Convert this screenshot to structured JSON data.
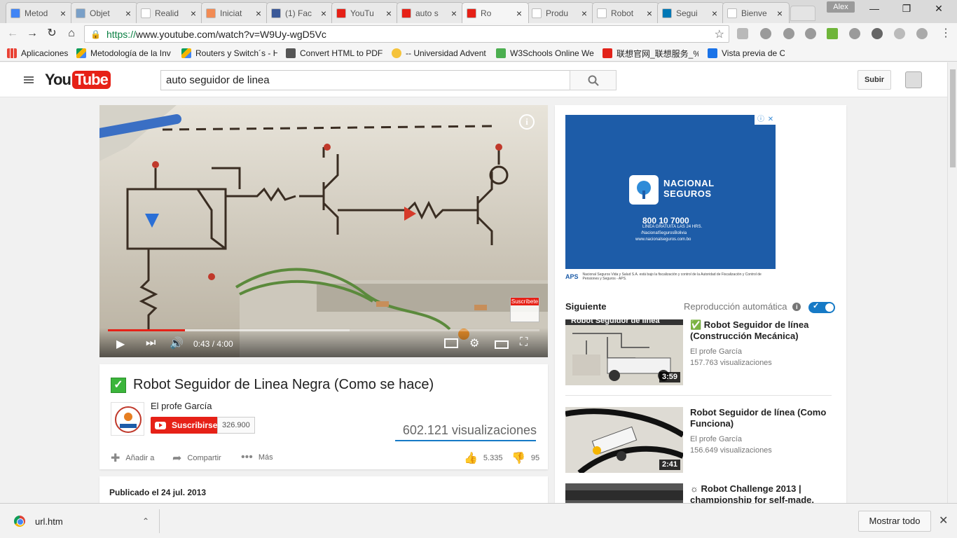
{
  "browser": {
    "tabs": [
      {
        "label": "Metod",
        "color": "#4285f4"
      },
      {
        "label": "Objet",
        "color": "#7aa0c8"
      },
      {
        "label": "Realid",
        "color": "#ffffff"
      },
      {
        "label": "Iniciat",
        "color": "#f28b54"
      },
      {
        "label": "(1) Fac",
        "color": "#3b5998"
      },
      {
        "label": "YouTu",
        "color": "#e62117"
      },
      {
        "label": "auto s",
        "color": "#e62117"
      },
      {
        "label": "Ro",
        "color": "#e62117"
      },
      {
        "label": "Produ",
        "color": "#ffffff"
      },
      {
        "label": "Robot",
        "color": "#ffffff"
      },
      {
        "label": "Segui",
        "color": "#0077b5"
      },
      {
        "label": "Bienve",
        "color": "#ffffff"
      }
    ],
    "active_tab_index": 7,
    "user": "Alex",
    "url_scheme": "https://",
    "url_rest": "www.youtube.com/watch?v=W9Uy-wgD5Vc",
    "bookmarks": [
      {
        "label": "Aplicaciones",
        "icon": "apps-grid-icon"
      },
      {
        "label": "Metodología de la Inv",
        "icon": "drive-icon"
      },
      {
        "label": "Routers y Switch´s - H",
        "icon": "drive-icon"
      },
      {
        "label": "Convert HTML to PDF",
        "icon": "pdf-icon"
      },
      {
        "label": "-- Universidad Advent",
        "icon": "emoji-icon"
      },
      {
        "label": "W3Schools Online We",
        "icon": "w3-icon"
      },
      {
        "label": "联想官网_联想服务_%",
        "icon": "lenovo-icon"
      },
      {
        "label": "Vista previa de Conta",
        "icon": "contact-icon"
      }
    ]
  },
  "youtube": {
    "logo_you": "You",
    "logo_tube": "Tube",
    "search_query": "auto seguidor de linea",
    "upload_label": "Subir"
  },
  "player": {
    "time": "0:43 / 4:00",
    "progress_played": 0.1792,
    "progress_loaded": 0.56,
    "overlay_subscribe": "Suscríbete"
  },
  "video": {
    "title": "Robot Seguidor de Linea Negra (Como se hace)",
    "channel": "El profe García",
    "subscribe_label": "Suscribirse",
    "subscriber_count": "326.900",
    "views": "602.121 visualizaciones",
    "actions": {
      "add_to": "Añadir a",
      "share": "Compartir",
      "more": "Más"
    },
    "likes": "5.335",
    "dislikes": "95",
    "published": "Publicado el 24 jul. 2013"
  },
  "ad": {
    "brand_line1": "NACIONAL",
    "brand_line2": "SEGUROS",
    "phone": "800 10 7000",
    "line1": "LÍNEA GRATUITA LAS 24 HRS.",
    "line2": "/NacionalSegurosBolivia",
    "line3": "www.nacionalseguros.com.bo",
    "footer_brand": "APS",
    "footer_text": "Nacional Seguros Vida y Salud S.A. está bajo la fiscalización y control de la Autoridad de Fiscalización y Control de Pensiones y Seguros - APS."
  },
  "sidebar": {
    "up_next": "Siguiente",
    "autoplay": "Reproducción automática",
    "autoplay_on": true,
    "items": [
      {
        "title": "✅ Robot Seguidor de línea (Construcción Mecánica)",
        "channel": "El profe García",
        "views": "157.763 visualizaciones",
        "duration": "3:59",
        "thumb_caption": "Robot Seguidor de línea"
      },
      {
        "title": "Robot Seguidor de línea (Como Funciona)",
        "channel": "El profe García",
        "views": "156.649 visualizaciones",
        "duration": "2:41"
      },
      {
        "title": "☼ Robot Challenge 2013 | championship for self-made,"
      }
    ]
  },
  "downloads": {
    "file": "url.htm",
    "show_all": "Mostrar todo"
  }
}
